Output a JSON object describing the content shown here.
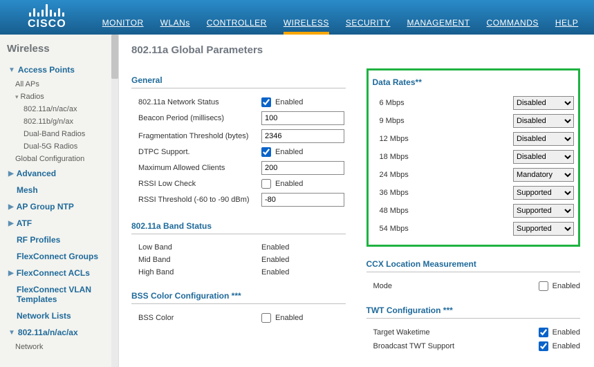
{
  "brand": "CISCO",
  "nav": [
    "MONITOR",
    "WLANs",
    "CONTROLLER",
    "WIRELESS",
    "SECURITY",
    "MANAGEMENT",
    "COMMANDS",
    "HELP"
  ],
  "nav_active": "WIRELESS",
  "sidebar": {
    "title": "Wireless",
    "access_points": {
      "label": "Access Points",
      "all_aps": "All APs",
      "radios": "Radios",
      "radio_items": [
        "802.11a/n/ac/ax",
        "802.11b/g/n/ax",
        "Dual-Band Radios",
        "Dual-5G Radios"
      ],
      "global_config": "Global Configuration"
    },
    "advanced": "Advanced",
    "mesh": "Mesh",
    "ap_group_ntp": "AP Group NTP",
    "atf": "ATF",
    "rf_profiles": "RF Profiles",
    "flexconnect_groups": "FlexConnect Groups",
    "flexconnect_acls": "FlexConnect ACLs",
    "flexconnect_vlan": "FlexConnect VLAN Templates",
    "network_lists": "Network Lists",
    "radio_section": {
      "label": "802.11a/n/ac/ax",
      "network": "Network"
    }
  },
  "page_title": "802.11a Global Parameters",
  "general": {
    "heading": "General",
    "net_status_label": "802.11a Network Status",
    "net_status_enabled": true,
    "enabled_text": "Enabled",
    "beacon_label": "Beacon Period (millisecs)",
    "beacon_value": "100",
    "frag_label": "Fragmentation Threshold (bytes)",
    "frag_value": "2346",
    "dtpc_label": "DTPC Support.",
    "dtpc_enabled": true,
    "maxclients_label": "Maximum Allowed Clients",
    "maxclients_value": "200",
    "rssi_low_label": "RSSI Low Check",
    "rssi_low_enabled": false,
    "rssi_thresh_label": "RSSI Threshold (-60 to -90 dBm)",
    "rssi_thresh_value": "-80"
  },
  "band": {
    "heading": "802.11a Band Status",
    "low_label": "Low Band",
    "low_value": "Enabled",
    "mid_label": "Mid Band",
    "mid_value": "Enabled",
    "high_label": "High Band",
    "high_value": "Enabled"
  },
  "bss": {
    "heading": "BSS Color Configuration ***",
    "color_label": "BSS Color",
    "color_enabled": false,
    "enabled_text": "Enabled"
  },
  "rates": {
    "heading": "Data Rates**",
    "r6_label": "6 Mbps",
    "r6_value": "Disabled",
    "r9_label": "9 Mbps",
    "r9_value": "Disabled",
    "r12_label": "12 Mbps",
    "r12_value": "Disabled",
    "r18_label": "18 Mbps",
    "r18_value": "Disabled",
    "r24_label": "24 Mbps",
    "r24_value": "Mandatory",
    "r36_label": "36 Mbps",
    "r36_value": "Supported",
    "r48_label": "48 Mbps",
    "r48_value": "Supported",
    "r54_label": "54 Mbps",
    "r54_value": "Supported",
    "options": [
      "Disabled",
      "Supported",
      "Mandatory"
    ]
  },
  "ccx": {
    "heading": "CCX Location Measurement",
    "mode_label": "Mode",
    "mode_enabled": false,
    "enabled_text": "Enabled"
  },
  "twt": {
    "heading": "TWT Configuration ***",
    "target_label": "Target Waketime",
    "target_enabled": true,
    "broadcast_label": "Broadcast TWT Support",
    "broadcast_enabled": true,
    "enabled_text": "Enabled"
  }
}
